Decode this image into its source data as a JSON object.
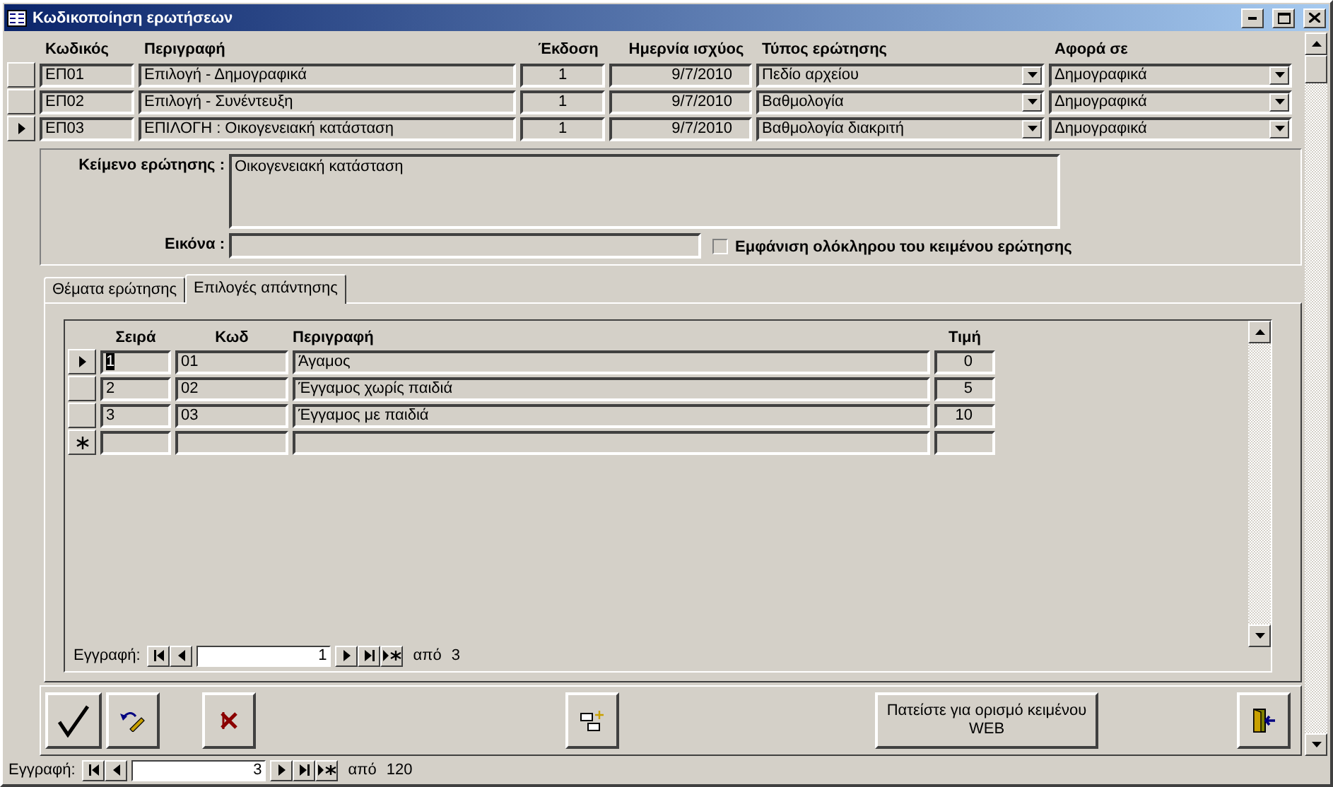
{
  "window": {
    "title": "Κωδικοποίηση ερωτήσεων"
  },
  "questions": {
    "columns": [
      "Κωδικός",
      "Περιγραφή",
      "Έκδοση",
      "Ημερνία ισχύος",
      "Τύπος ερώτησης",
      "Αφορά σε"
    ],
    "rows": [
      {
        "code": "ΕΠ01",
        "description": "Επιλογή - Δημογραφικά",
        "version": "1",
        "date": "9/7/2010",
        "type": "Πεδίο αρχείου",
        "concerns": "Δημογραφικά",
        "selected": false
      },
      {
        "code": "ΕΠ02",
        "description": "Επιλογή - Συνέντευξη",
        "version": "1",
        "date": "9/7/2010",
        "type": "Βαθμολογία",
        "concerns": "Δημογραφικά",
        "selected": false
      },
      {
        "code": "ΕΠ03",
        "description": "ΕΠΙΛΟΓΗ : Οικογενειακή κατάσταση",
        "version": "1",
        "date": "9/7/2010",
        "type": "Βαθμολογία διακριτή",
        "concerns": "Δημογραφικά",
        "selected": true
      }
    ]
  },
  "detail": {
    "text_label": "Κείμενο ερώτησης :",
    "text_value": "Οικογενειακή κατάσταση",
    "image_label": "Εικόνα :",
    "show_full": {
      "label": "Εμφάνιση ολόκληρου του κειμένου ερώτησης",
      "checked": false
    }
  },
  "tabs": [
    {
      "label": "Θέματα ερώτησης",
      "selected": false
    },
    {
      "label": "Επιλογές απάντησης",
      "selected": true
    }
  ],
  "answers": {
    "columns": [
      "Σειρά",
      "Κωδ",
      "Περιγραφή",
      "Τιμή"
    ],
    "rows": [
      {
        "order": "1",
        "code": "01",
        "description": "Άγαμος",
        "value": "0",
        "selected": true
      },
      {
        "order": "2",
        "code": "02",
        "description": "Έγγαμος χωρίς παιδιά",
        "value": "5",
        "selected": false
      },
      {
        "order": "3",
        "code": "03",
        "description": "Έγγαμος με παιδιά",
        "value": "10",
        "selected": false
      }
    ],
    "navigation": {
      "label": "Εγγραφή:",
      "current": "1",
      "of": "από",
      "total": "3"
    }
  },
  "buttons": [
    {
      "kind": "save"
    },
    {
      "kind": "undo"
    },
    {
      "kind": "delete"
    },
    {
      "kind": "find"
    },
    {
      "kind": "text",
      "label": "Πατείστε για ορισμό κειμένου WEB"
    },
    {
      "kind": "exit"
    }
  ],
  "navigation": {
    "label": "Εγγραφή:",
    "current": "3",
    "of": "από",
    "total": "120"
  }
}
